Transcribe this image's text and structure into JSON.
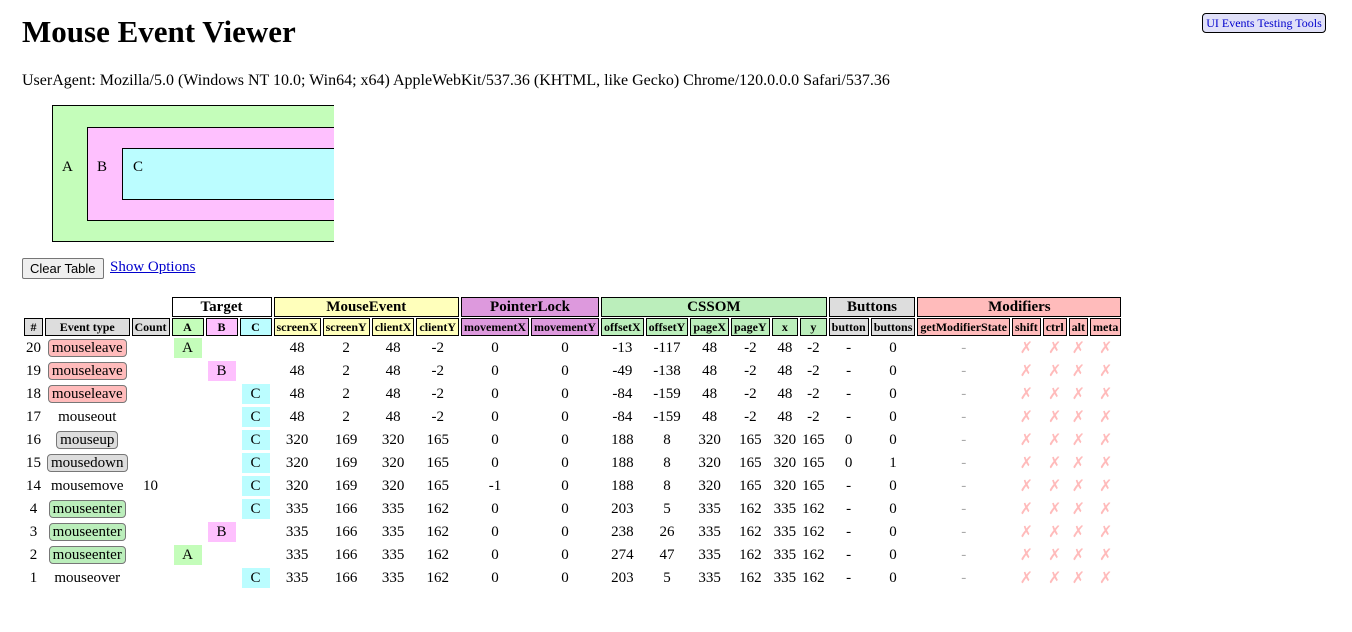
{
  "title": "Mouse Event Viewer",
  "tools_link": "UI Events Testing Tools",
  "user_agent": "UserAgent: Mozilla/5.0 (Windows NT 10.0; Win64; x64) AppleWebKit/537.36 (KHTML, like Gecko) Chrome/120.0.0.0 Safari/537.36",
  "boxes": {
    "a": "A",
    "b": "B",
    "c": "C"
  },
  "controls": {
    "clear_table": "Clear Table",
    "show_options": "Show Options"
  },
  "colors": {
    "target_a": "#c4fdba",
    "target_b": "#fec0fe",
    "target_c": "#bbfdff",
    "mouseevent": "#ffffbb",
    "pointerlock": "#dd99dd",
    "cssom": "#bbeebb",
    "buttons": "#dddddd",
    "modifiers": "#ffbbbb"
  },
  "table": {
    "groups": {
      "target": "Target",
      "mouseevent": "MouseEvent",
      "pointerlock": "PointerLock",
      "cssom": "CSSOM",
      "buttons": "Buttons",
      "modifiers": "Modifiers"
    },
    "columns": [
      "#",
      "Event type",
      "Count",
      "A",
      "B",
      "C",
      "screenX",
      "screenY",
      "clientX",
      "clientY",
      "movementX",
      "movementY",
      "offsetX",
      "offsetY",
      "pageX",
      "pageY",
      "x",
      "y",
      "button",
      "buttons",
      "getModifierState",
      "shift",
      "ctrl",
      "alt",
      "meta"
    ],
    "rows": [
      {
        "n": "20",
        "type": "mouseleave",
        "style": "red",
        "count": "",
        "target": "A",
        "v": [
          "48",
          "2",
          "48",
          "-2",
          "0",
          "0",
          "-13",
          "-117",
          "48",
          "-2",
          "48",
          "-2",
          "-",
          "0"
        ]
      },
      {
        "n": "19",
        "type": "mouseleave",
        "style": "red",
        "count": "",
        "target": "B",
        "v": [
          "48",
          "2",
          "48",
          "-2",
          "0",
          "0",
          "-49",
          "-138",
          "48",
          "-2",
          "48",
          "-2",
          "-",
          "0"
        ]
      },
      {
        "n": "18",
        "type": "mouseleave",
        "style": "red",
        "count": "",
        "target": "C",
        "v": [
          "48",
          "2",
          "48",
          "-2",
          "0",
          "0",
          "-84",
          "-159",
          "48",
          "-2",
          "48",
          "-2",
          "-",
          "0"
        ]
      },
      {
        "n": "17",
        "type": "mouseout",
        "style": "plain",
        "count": "",
        "target": "C",
        "v": [
          "48",
          "2",
          "48",
          "-2",
          "0",
          "0",
          "-84",
          "-159",
          "48",
          "-2",
          "48",
          "-2",
          "-",
          "0"
        ]
      },
      {
        "n": "16",
        "type": "mouseup",
        "style": "gray",
        "count": "",
        "target": "C",
        "v": [
          "320",
          "169",
          "320",
          "165",
          "0",
          "0",
          "188",
          "8",
          "320",
          "165",
          "320",
          "165",
          "0",
          "0"
        ]
      },
      {
        "n": "15",
        "type": "mousedown",
        "style": "gray",
        "count": "",
        "target": "C",
        "v": [
          "320",
          "169",
          "320",
          "165",
          "0",
          "0",
          "188",
          "8",
          "320",
          "165",
          "320",
          "165",
          "0",
          "1"
        ]
      },
      {
        "n": "14",
        "type": "mousemove",
        "style": "plain",
        "count": "10",
        "target": "C",
        "v": [
          "320",
          "169",
          "320",
          "165",
          "-1",
          "0",
          "188",
          "8",
          "320",
          "165",
          "320",
          "165",
          "-",
          "0"
        ]
      },
      {
        "n": "4",
        "type": "mouseenter",
        "style": "green",
        "count": "",
        "target": "C",
        "v": [
          "335",
          "166",
          "335",
          "162",
          "0",
          "0",
          "203",
          "5",
          "335",
          "162",
          "335",
          "162",
          "-",
          "0"
        ]
      },
      {
        "n": "3",
        "type": "mouseenter",
        "style": "green",
        "count": "",
        "target": "B",
        "v": [
          "335",
          "166",
          "335",
          "162",
          "0",
          "0",
          "238",
          "26",
          "335",
          "162",
          "335",
          "162",
          "-",
          "0"
        ]
      },
      {
        "n": "2",
        "type": "mouseenter",
        "style": "green",
        "count": "",
        "target": "A",
        "v": [
          "335",
          "166",
          "335",
          "162",
          "0",
          "0",
          "274",
          "47",
          "335",
          "162",
          "335",
          "162",
          "-",
          "0"
        ]
      },
      {
        "n": "1",
        "type": "mouseover",
        "style": "plain",
        "count": "",
        "target": "C",
        "v": [
          "335",
          "166",
          "335",
          "162",
          "0",
          "0",
          "203",
          "5",
          "335",
          "162",
          "335",
          "162",
          "-",
          "0"
        ]
      }
    ],
    "modifier_state": "-",
    "modifier_mark": "✗"
  }
}
